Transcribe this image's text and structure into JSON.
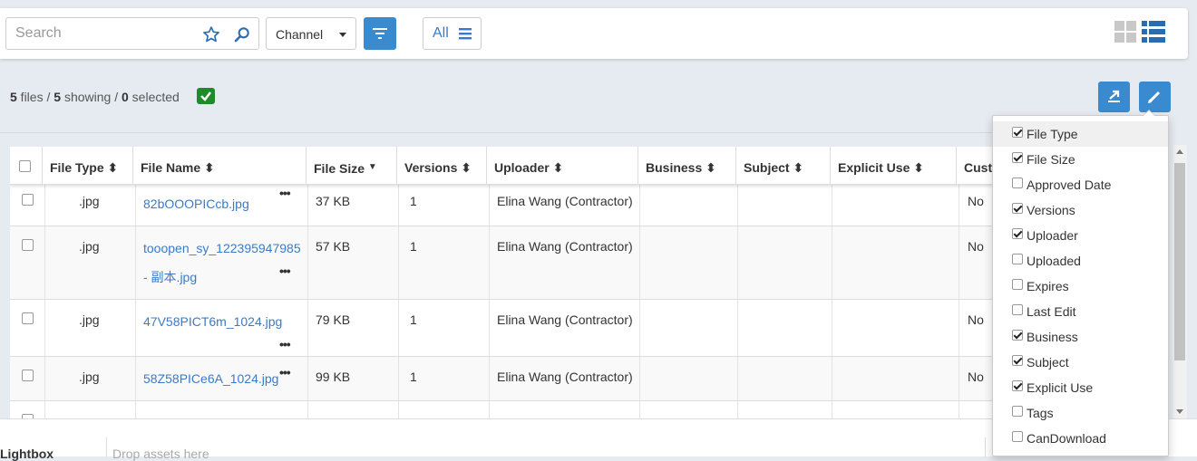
{
  "search": {
    "placeholder": "Search"
  },
  "channel": {
    "label": "Channel"
  },
  "all_button": {
    "label": "All"
  },
  "summary": {
    "files": "5",
    "files_label": " files / ",
    "showing": "5",
    "showing_label": " showing / ",
    "selected": "0",
    "selected_label": " selected"
  },
  "table": {
    "headers": [
      "File Type",
      "File Name",
      "File Size",
      "Versions",
      "Uploader",
      "Business",
      "Subject",
      "Explicit Use",
      "Cust"
    ],
    "rows": [
      {
        "file_type": ".jpg",
        "file_name": "82bOOOPICcb.jpg",
        "file_name_2": "",
        "file_size": "37 KB",
        "versions": "1",
        "uploader": "Elina Wang (Contractor)",
        "custom": "No"
      },
      {
        "file_type": ".jpg",
        "file_name": "tooopen_sy_122395947985",
        "file_name_2": "- 副本.jpg",
        "file_size": "57 KB",
        "versions": "1",
        "uploader": "Elina Wang (Contractor)",
        "custom": "No"
      },
      {
        "file_type": ".jpg",
        "file_name": "47V58PICT6m_1024.jpg",
        "file_name_2": "",
        "file_size": "79 KB",
        "versions": "1",
        "uploader": "Elina Wang (Contractor)",
        "custom": "No"
      },
      {
        "file_type": ".jpg",
        "file_name": "58Z58PICe6A_1024.jpg",
        "file_name_2": "",
        "file_size": "99 KB",
        "versions": "1",
        "uploader": "Elina Wang (Contractor)",
        "custom": "No"
      }
    ]
  },
  "column_menu": {
    "items": [
      {
        "label": "File Type",
        "checked": true
      },
      {
        "label": "File Size",
        "checked": true
      },
      {
        "label": "Approved Date",
        "checked": false
      },
      {
        "label": "Versions",
        "checked": true
      },
      {
        "label": "Uploader",
        "checked": true
      },
      {
        "label": "Uploaded",
        "checked": false
      },
      {
        "label": "Expires",
        "checked": false
      },
      {
        "label": "Last Edit",
        "checked": false
      },
      {
        "label": "Business",
        "checked": true
      },
      {
        "label": "Subject",
        "checked": true
      },
      {
        "label": "Explicit Use",
        "checked": true
      },
      {
        "label": "Tags",
        "checked": false
      },
      {
        "label": "CanDownload",
        "checked": false
      }
    ]
  },
  "lightbox": {
    "title": "Lightbox",
    "drop_text": "Drop assets here"
  },
  "colors": {
    "primary": "#3a8ad0",
    "link": "#3a7bc8",
    "success": "#1f8a2c",
    "background": "#e6ebf1"
  }
}
